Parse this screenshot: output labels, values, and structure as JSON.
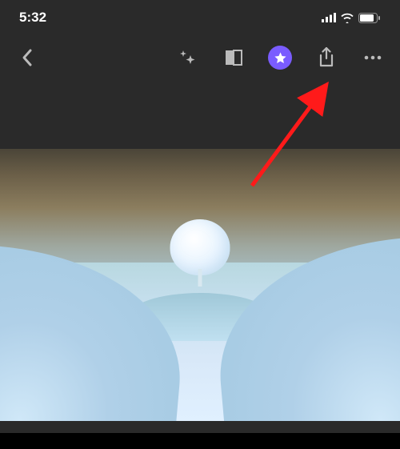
{
  "statusBar": {
    "time": "5:32"
  },
  "toolbar": {
    "icons": {
      "back": "back-chevron",
      "enhance": "sparkles",
      "filter": "filter-panel",
      "favorite": "star",
      "share": "share",
      "more": "ellipsis"
    },
    "favoriteColor": "#7a5cff"
  },
  "annotation": {
    "arrowTarget": "share-button",
    "arrowColor": "#ff1a1a"
  }
}
